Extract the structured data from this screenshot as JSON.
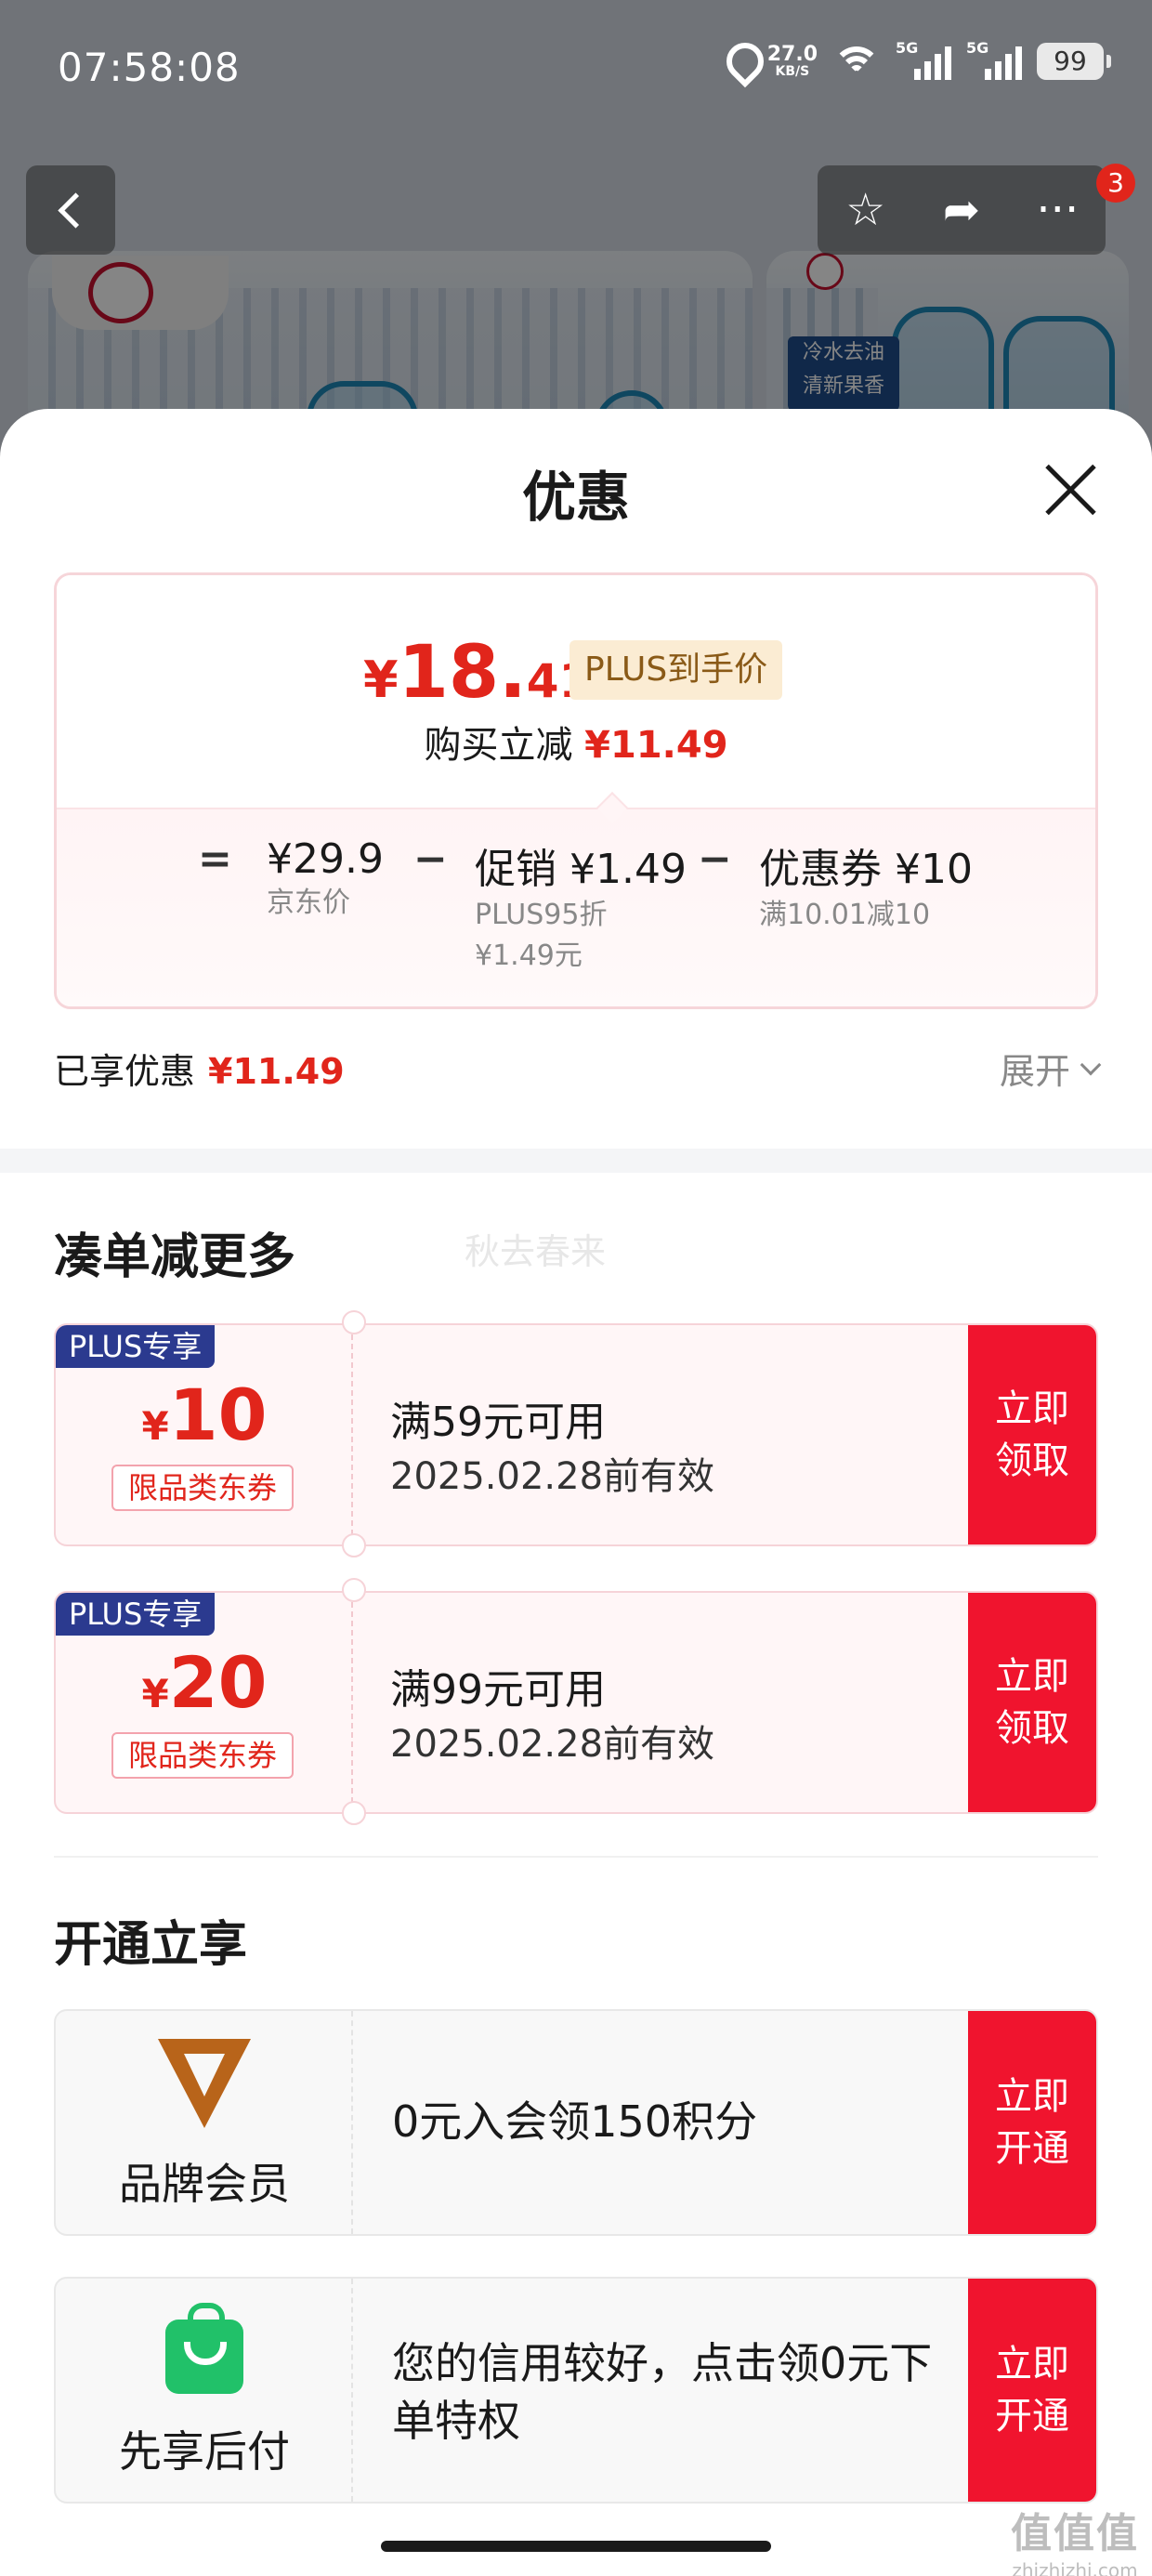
{
  "status_bar": {
    "time": "07:58:08",
    "net_speed": "27.0",
    "net_unit": "KB/S",
    "signal_1": "5G",
    "signal_2": "5G",
    "battery": "99"
  },
  "background": {
    "product_tag_line1": "冷水去油",
    "product_tag_line2": "清新果香",
    "cart_badge": "3"
  },
  "sheet": {
    "title": "优惠",
    "price_card": {
      "final_currency": "¥",
      "final_int": "18.",
      "final_dec": "41",
      "final_tag": "PLUS到手价",
      "reduce_label": "购买立减",
      "reduce_amount": "¥11.49",
      "equation": {
        "eq_sign": "=",
        "jd_price": "¥29.9",
        "jd_price_label": "京东价",
        "minus_1": "−",
        "promo": "促销 ¥1.49",
        "promo_sub1": "PLUS95折",
        "promo_sub2": "¥1.49元",
        "minus_2": "−",
        "coupon": "优惠券 ¥10",
        "coupon_sub": "满10.01减10"
      }
    },
    "enjoyed_label": "已享优惠",
    "enjoyed_amount": "¥11.49",
    "expand_label": "展开",
    "section_combine": "凑单减更多",
    "watermark": "秋去春来",
    "coupons": [
      {
        "plus_label": "PLUS专享",
        "currency": "¥",
        "amount": "10",
        "scope": "限品类东券",
        "condition": "满59元可用",
        "validity": "2025.02.28前有效",
        "button": "立即\n领取",
        "button_l1": "立即",
        "button_l2": "领取"
      },
      {
        "plus_label": "PLUS专享",
        "currency": "¥",
        "amount": "20",
        "scope": "限品类东券",
        "condition": "满99元可用",
        "validity": "2025.02.28前有效",
        "button_l1": "立即",
        "button_l2": "领取"
      }
    ],
    "section_open": "开通立享",
    "members": [
      {
        "icon": "brand-v-icon",
        "label": "品牌会员",
        "desc": "0元入会领150积分",
        "button_l1": "立即",
        "button_l2": "开通"
      },
      {
        "icon": "shopping-bag-icon",
        "label": "先享后付",
        "desc": "您的信用较好，点击领0元下单特权",
        "button_l1": "立即",
        "button_l2": "开通"
      }
    ]
  },
  "site_mark": {
    "big": "值值值",
    "small": "zhizhizhi.com"
  },
  "colors": {
    "accent_red": "#e1251b",
    "button_red": "#f0142e",
    "plus_navy": "#2b3a8f",
    "plus_tag_bg": "#fbecd3"
  }
}
